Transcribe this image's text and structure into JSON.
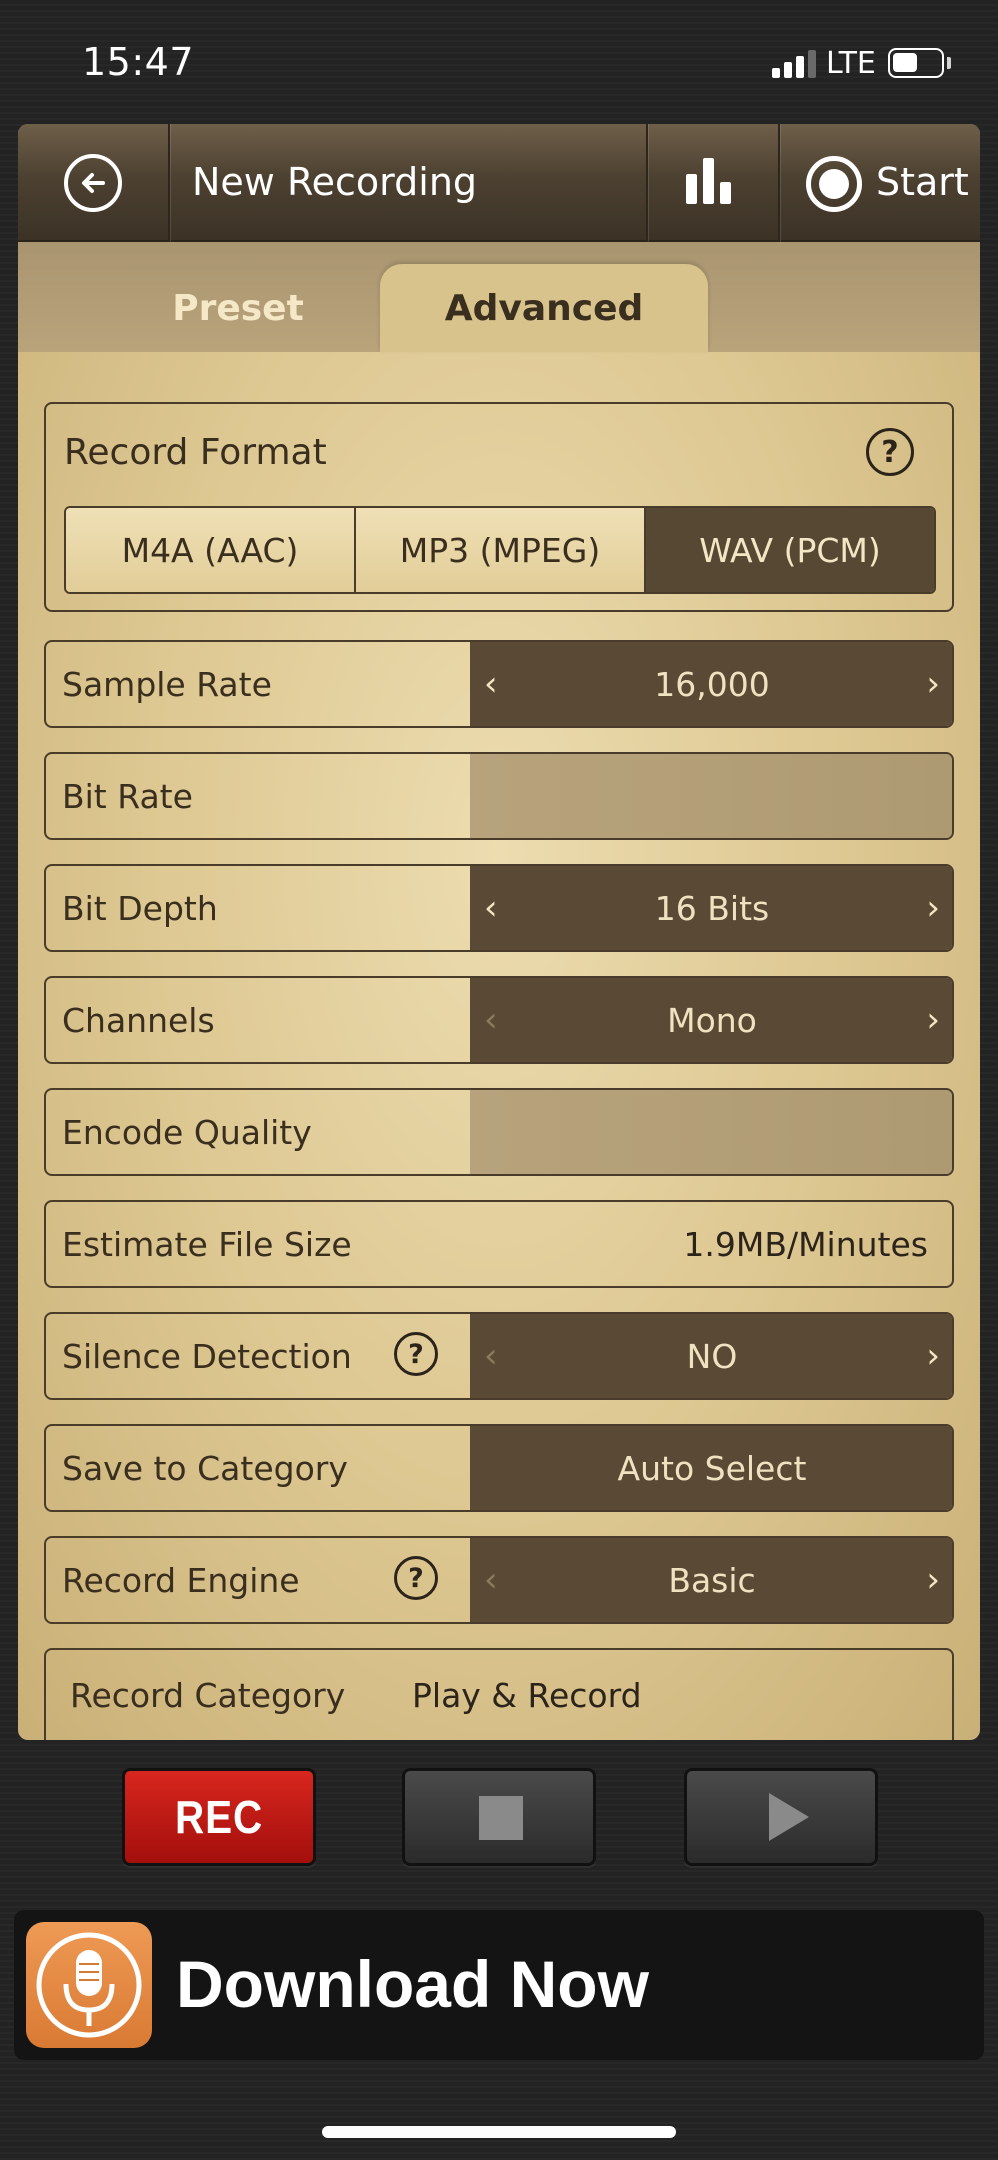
{
  "status_bar": {
    "time": "15:47",
    "network": "LTE"
  },
  "nav": {
    "title": "New Recording",
    "start_label": "Start"
  },
  "tabs": [
    {
      "label": "Preset",
      "selected": false
    },
    {
      "label": "Advanced",
      "selected": true
    }
  ],
  "record_format": {
    "label": "Record Format",
    "help": "?",
    "options": [
      "M4A (AAC)",
      "MP3 (MPEG)",
      "WAV (PCM)"
    ],
    "selected": "WAV (PCM)"
  },
  "settings": {
    "sample_rate": {
      "label": "Sample Rate",
      "value": "16,000"
    },
    "bit_rate": {
      "label": "Bit Rate",
      "value": ""
    },
    "bit_depth": {
      "label": "Bit Depth",
      "value": "16 Bits"
    },
    "channels": {
      "label": "Channels",
      "value": "Mono"
    },
    "encode_quality": {
      "label": "Encode Quality",
      "value": ""
    },
    "estimate_file_size": {
      "label": "Estimate File Size",
      "value": "1.9MB/Minutes"
    },
    "silence_detection": {
      "label": "Silence Detection",
      "help": "?",
      "value": "NO"
    },
    "save_to_category": {
      "label": "Save to Category",
      "value": "Auto Select"
    },
    "record_engine": {
      "label": "Record Engine",
      "help": "?",
      "value": "Basic"
    },
    "record_category": {
      "label": "Record Category",
      "value": "Play & Record"
    }
  },
  "controls": {
    "rec_label": "REC"
  },
  "ad": {
    "text": "Download Now"
  },
  "colors": {
    "value_bg": "#5a4a35",
    "rec_red": "#c41d17",
    "panel_gold": "#dcc690"
  }
}
